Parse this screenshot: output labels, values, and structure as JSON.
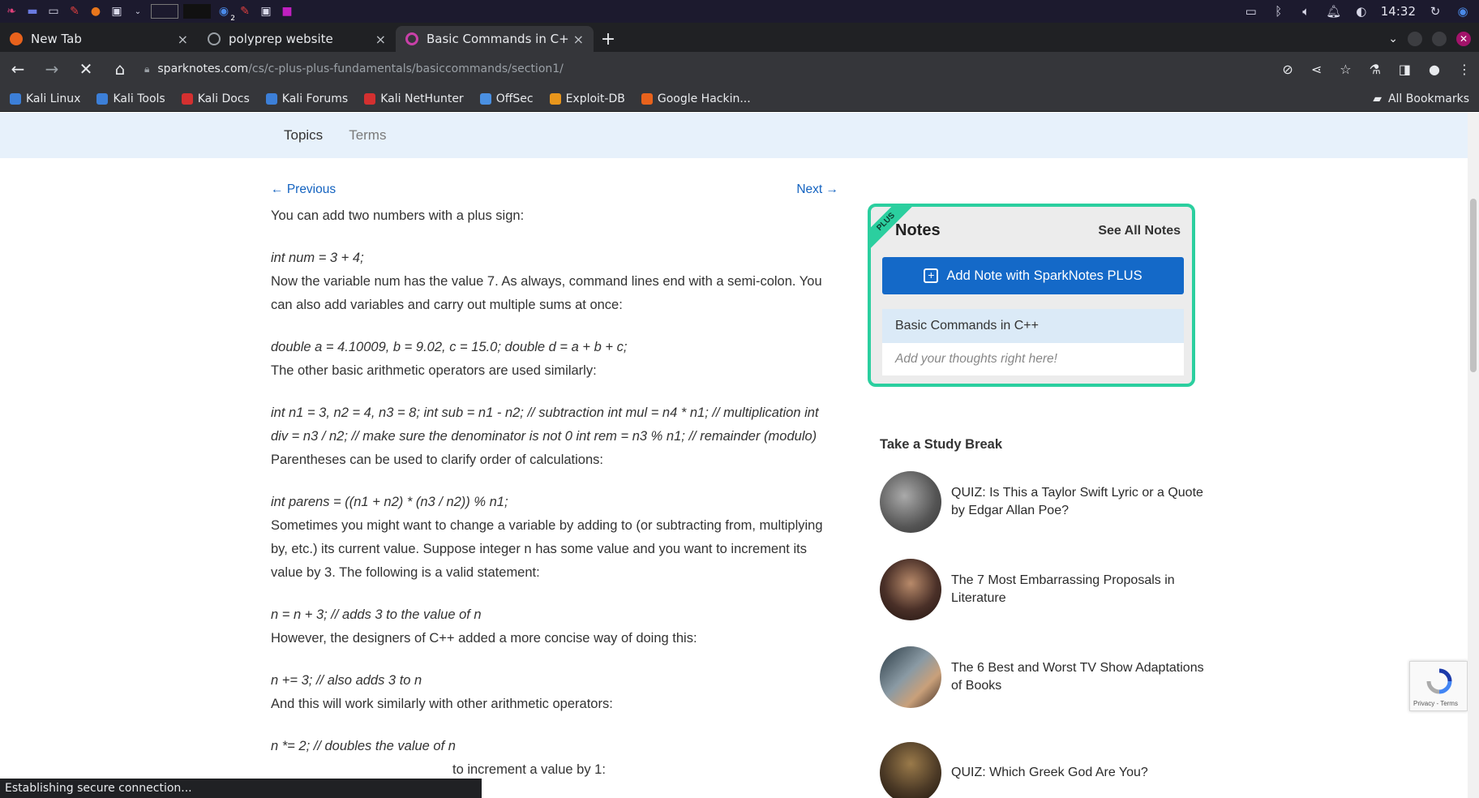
{
  "taskbar": {
    "clock": "14:32",
    "badge_count": "2"
  },
  "tabs": [
    {
      "label": "New Tab",
      "active": false,
      "color": "#e8621c"
    },
    {
      "label": "polyprep website",
      "active": false,
      "color": "#9aa0a6"
    },
    {
      "label": "Basic Commands in C++:",
      "active": true,
      "color": "#c940a8"
    }
  ],
  "toolbar": {
    "url_host": "sparknotes.com",
    "url_path": "/cs/c-plus-plus-fundamentals/basiccommands/section1/"
  },
  "bookmarks": {
    "items": [
      {
        "label": "Kali Linux",
        "color": "#3c7fd8"
      },
      {
        "label": "Kali Tools",
        "color": "#3c7fd8"
      },
      {
        "label": "Kali Docs",
        "color": "#d43030"
      },
      {
        "label": "Kali Forums",
        "color": "#3c7fd8"
      },
      {
        "label": "Kali NetHunter",
        "color": "#d43030"
      },
      {
        "label": "OffSec",
        "color": "#4a90e2"
      },
      {
        "label": "Exploit-DB",
        "color": "#e8961c"
      },
      {
        "label": "Google Hackin...",
        "color": "#e8621c"
      }
    ],
    "all_label": "All Bookmarks"
  },
  "subnav": {
    "topics": "Topics",
    "terms": "Terms"
  },
  "article": {
    "previous": "Previous",
    "next": "Next",
    "blocks": [
      {
        "type": "text",
        "value": "You can add two numbers with a plus sign:"
      },
      {
        "type": "code",
        "value": "int num = 3 + 4;"
      },
      {
        "type": "text",
        "value": "Now the variable num has the value 7. As always, command lines end with a semi-colon. You can also add variables and carry out multiple sums at once:"
      },
      {
        "type": "code",
        "value": "double a = 4.10009, b = 9.02, c = 15.0; double d = a + b + c;"
      },
      {
        "type": "text",
        "value": "The other basic arithmetic operators are used similarly:"
      },
      {
        "type": "code",
        "value": "int n1 = 3, n2 = 4, n3 = 8; int sub = n1 - n2; // subtraction int mul = n4 * n1; // multiplication int div = n3 / n2; // make sure the denominator is not 0 int rem = n3 % n1; // remainder (modulo)"
      },
      {
        "type": "text",
        "value": "Parentheses can be used to clarify order of calculations:"
      },
      {
        "type": "code",
        "value": "int parens = ((n1 + n2) * (n3 / n2)) % n1;"
      },
      {
        "type": "text",
        "value": "Sometimes you might want to change a variable by adding to (or subtracting from, multiplying by, etc.) its current value. Suppose integer n has some value and you want to increment its value by 3. The following is a valid statement:"
      },
      {
        "type": "code",
        "value": "n = n + 3; // adds 3 to the value of n"
      },
      {
        "type": "text",
        "value": "However, the designers of C++ added a more concise way of doing this:"
      },
      {
        "type": "code",
        "value": "n += 3; // also adds 3 to n"
      },
      {
        "type": "text",
        "value": "And this will work similarly with other arithmetic operators:"
      },
      {
        "type": "code",
        "value": "n *= 2; // doubles the value of n"
      },
      {
        "type": "text",
        "value": "to increment a value by 1:"
      }
    ]
  },
  "notes": {
    "ribbon": "PLUS",
    "title": "Notes",
    "see_all": "See All Notes",
    "add_button": "Add Note with SparkNotes PLUS",
    "card_title": "Basic Commands in C++",
    "placeholder": "Add your thoughts right here!",
    "accent": "#2bcf9f",
    "button_color": "#1469c8"
  },
  "study_break": {
    "title": "Take a Study Break",
    "items": [
      {
        "label": "QUIZ: Is This a Taylor Swift Lyric or a Quote by Edgar Allan Poe?",
        "color": "#6e7176"
      },
      {
        "label": "The 7 Most Embarrassing Proposals in Literature",
        "color": "#4a3028"
      },
      {
        "label": "The 6 Best and Worst TV Show Adaptations of Books",
        "color": "#5a6670"
      },
      {
        "label": "QUIZ: Which Greek God Are You?",
        "color": "#4c3a26"
      }
    ]
  },
  "recaptcha": {
    "text": "Privacy - Terms"
  },
  "status": {
    "text": "Establishing secure connection..."
  }
}
